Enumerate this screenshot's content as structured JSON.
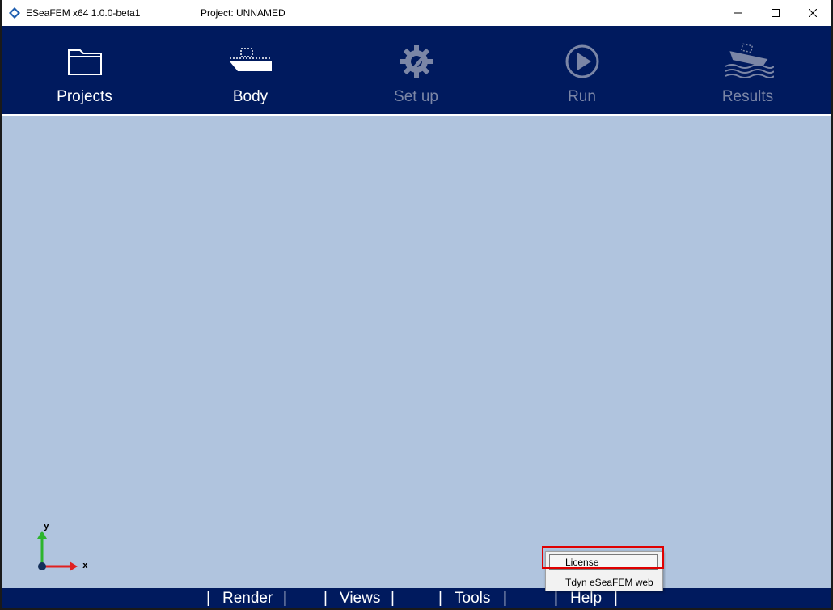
{
  "titlebar": {
    "app_title": "ESeaFEM x64 1.0.0-beta1",
    "project_title": "Project: UNNAMED",
    "icon": "app-diamond-icon"
  },
  "toolbar": {
    "items": [
      {
        "label": "Projects",
        "icon": "folder-icon",
        "enabled": true
      },
      {
        "label": "Body",
        "icon": "ship-icon",
        "enabled": true
      },
      {
        "label": "Set up",
        "icon": "gear-wrench-icon",
        "enabled": false
      },
      {
        "label": "Run",
        "icon": "play-icon",
        "enabled": false
      },
      {
        "label": "Results",
        "icon": "ship-waves-icon",
        "enabled": false
      }
    ]
  },
  "axes": {
    "x_label": "x",
    "y_label": "y"
  },
  "menubar": {
    "items": [
      "Render",
      "Views",
      "Tools",
      "Help"
    ],
    "separator": "|"
  },
  "context_menu": {
    "items": [
      "License",
      "Tdyn eSeaFEM web"
    ]
  },
  "colors": {
    "toolbar_bg": "#001a5e",
    "viewport_bg": "#b0c4de",
    "disabled_text": "#7b86a6",
    "highlight": "#e00000"
  }
}
